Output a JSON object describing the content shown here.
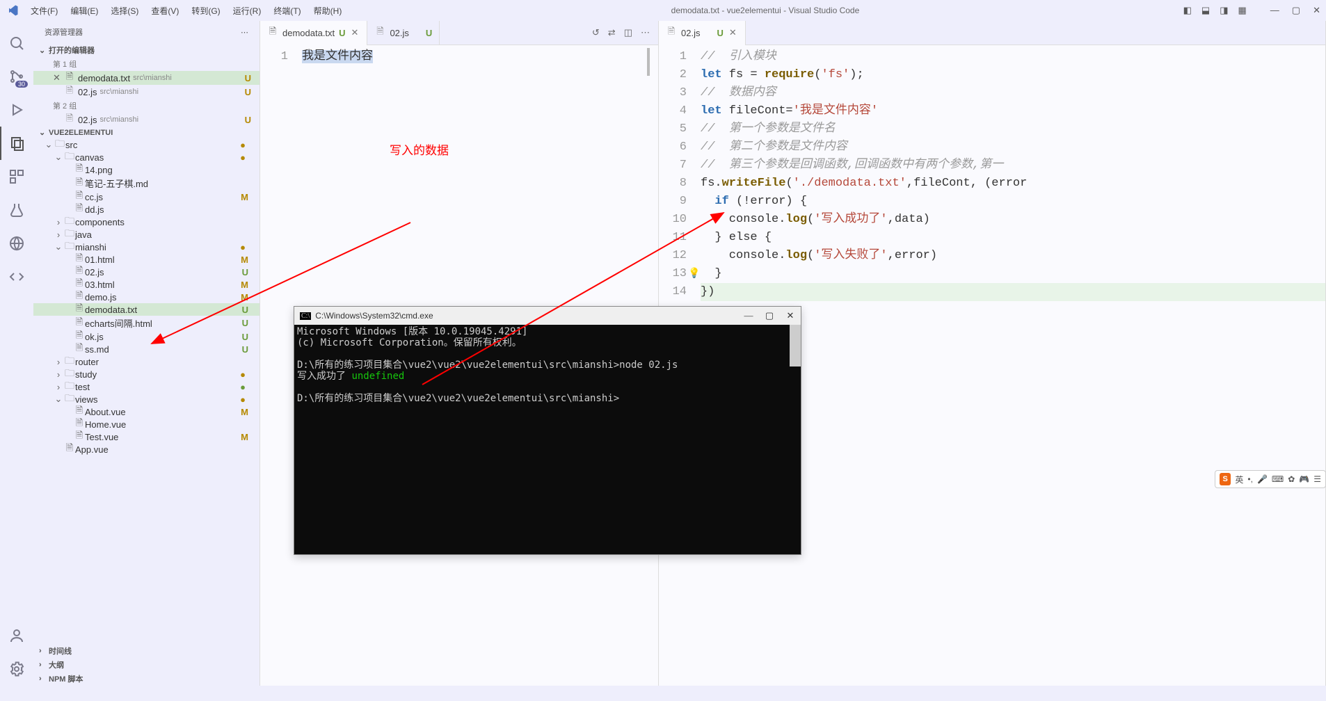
{
  "titlebar": {
    "title": "demodata.txt - vue2elementui - Visual Studio Code",
    "menu": [
      "文件(F)",
      "编辑(E)",
      "选择(S)",
      "查看(V)",
      "转到(G)",
      "运行(R)",
      "终端(T)",
      "帮助(H)"
    ]
  },
  "activity": {
    "badge": "30"
  },
  "sidebar": {
    "title": "资源管理器",
    "open_editors": "打开的编辑器",
    "group1": "第 1 组",
    "group2": "第 2 组",
    "project": "VUE2ELEMENTUI",
    "editors_g1": [
      {
        "name": "demodata.txt",
        "path": "src\\mianshi",
        "status": "U",
        "active": true
      },
      {
        "name": "02.js",
        "path": "src\\mianshi",
        "status": "U"
      }
    ],
    "editors_g2": [
      {
        "name": "02.js",
        "path": "src\\mianshi",
        "status": "U"
      }
    ],
    "tree": [
      {
        "type": "folder",
        "name": "src",
        "depth": 0,
        "open": true,
        "dot": "yellow"
      },
      {
        "type": "folder",
        "name": "canvas",
        "depth": 1,
        "open": true,
        "dot": "yellow"
      },
      {
        "type": "file",
        "name": "14.png",
        "depth": 2
      },
      {
        "type": "file",
        "name": "笔记-五子棋.md",
        "depth": 2
      },
      {
        "type": "file",
        "name": "cc.js",
        "depth": 2,
        "status": "M"
      },
      {
        "type": "file",
        "name": "dd.js",
        "depth": 2
      },
      {
        "type": "folder",
        "name": "components",
        "depth": 1,
        "open": false
      },
      {
        "type": "folder",
        "name": "java",
        "depth": 1,
        "open": false
      },
      {
        "type": "folder",
        "name": "mianshi",
        "depth": 1,
        "open": true,
        "dot": "yellow"
      },
      {
        "type": "file",
        "name": "01.html",
        "depth": 2,
        "status": "M"
      },
      {
        "type": "file",
        "name": "02.js",
        "depth": 2,
        "status": "U"
      },
      {
        "type": "file",
        "name": "03.html",
        "depth": 2,
        "status": "M"
      },
      {
        "type": "file",
        "name": "demo.js",
        "depth": 2,
        "status": "M"
      },
      {
        "type": "file",
        "name": "demodata.txt",
        "depth": 2,
        "status": "U",
        "selected": true
      },
      {
        "type": "file",
        "name": "echarts间隔.html",
        "depth": 2,
        "status": "U"
      },
      {
        "type": "file",
        "name": "ok.js",
        "depth": 2,
        "status": "U"
      },
      {
        "type": "file",
        "name": "ss.md",
        "depth": 2,
        "status": "U"
      },
      {
        "type": "folder",
        "name": "router",
        "depth": 1,
        "open": false
      },
      {
        "type": "folder",
        "name": "study",
        "depth": 1,
        "open": false,
        "dot": "yellow"
      },
      {
        "type": "folder",
        "name": "test",
        "depth": 1,
        "open": false,
        "dot": "green"
      },
      {
        "type": "folder",
        "name": "views",
        "depth": 1,
        "open": true,
        "dot": "yellow"
      },
      {
        "type": "file",
        "name": "About.vue",
        "depth": 2,
        "status": "M"
      },
      {
        "type": "file",
        "name": "Home.vue",
        "depth": 2
      },
      {
        "type": "file",
        "name": "Test.vue",
        "depth": 2,
        "status": "M"
      },
      {
        "type": "file",
        "name": "App.vue",
        "depth": 1
      }
    ],
    "bottom": [
      "时间线",
      "大纲",
      "NPM 脚本"
    ]
  },
  "pane1": {
    "tabs": [
      {
        "name": "demodata.txt",
        "status": "U",
        "active": true,
        "closable": true
      },
      {
        "name": "02.js",
        "status": "U"
      }
    ],
    "line1_num": "1",
    "line1_text": "我是文件内容"
  },
  "pane2": {
    "tabs": [
      {
        "name": "02.js",
        "status": "U",
        "active": true,
        "closable": true
      }
    ],
    "lines": {
      "n1": "1",
      "t1_a": "//",
      "t1_b": "  引入模块",
      "n2": "2",
      "t2_let": "let",
      "t2_fs": " fs = ",
      "t2_req": "require",
      "t2_paren": "(",
      "t2_str": "'fs'",
      "t2_end": ");",
      "n3": "3",
      "t3_a": "//",
      "t3_b": "  数据内容",
      "n4": "4",
      "t4_let": "let",
      "t4_mid": " fileCont=",
      "t4_str": "'我是文件内容'",
      "n5": "5",
      "t5_a": "//",
      "t5_b": "  第一个参数是文件名",
      "n6": "6",
      "t6_a": "//",
      "t6_b": "  第二个参数是文件内容",
      "n7": "7",
      "t7_a": "//",
      "t7_b": "  第三个参数是回调函数,回调函数中有两个参数,第一",
      "n8": "8",
      "t8_fs": "fs.",
      "t8_write": "writeFile",
      "t8_p": "(",
      "t8_str": "'./demodata.txt'",
      "t8_mid": ",fileCont, (error",
      "n9": "9",
      "t9_if": "  if ",
      "t9_cond": "(!error) {",
      "n10": "10",
      "t10_a": "    console.",
      "t10_log": "log",
      "t10_p": "(",
      "t10_str": "'写入成功了'",
      "t10_end": ",data)",
      "n11": "11",
      "t11": "  } else {",
      "n12": "12",
      "t12_a": "    console.",
      "t12_log": "log",
      "t12_p": "(",
      "t12_str": "'写入失败了'",
      "t12_end": ",error)",
      "n13": "13",
      "t13": "  }",
      "n14": "14",
      "t14": "})"
    }
  },
  "annotations": {
    "note": "写入的数据"
  },
  "cmd": {
    "title": "C:\\Windows\\System32\\cmd.exe",
    "line1": "Microsoft Windows [版本 10.0.19045.4291]",
    "line2": "(c) Microsoft Corporation。保留所有权利。",
    "line3": "D:\\所有的练习项目集合\\vue2\\vue2\\vue2elementui\\src\\mianshi>node 02.js",
    "line4a": "写入成功了 ",
    "line4b": "undefined",
    "line5": "D:\\所有的练习项目集合\\vue2\\vue2\\vue2elementui\\src\\mianshi>"
  },
  "ime": {
    "lang": "英"
  }
}
